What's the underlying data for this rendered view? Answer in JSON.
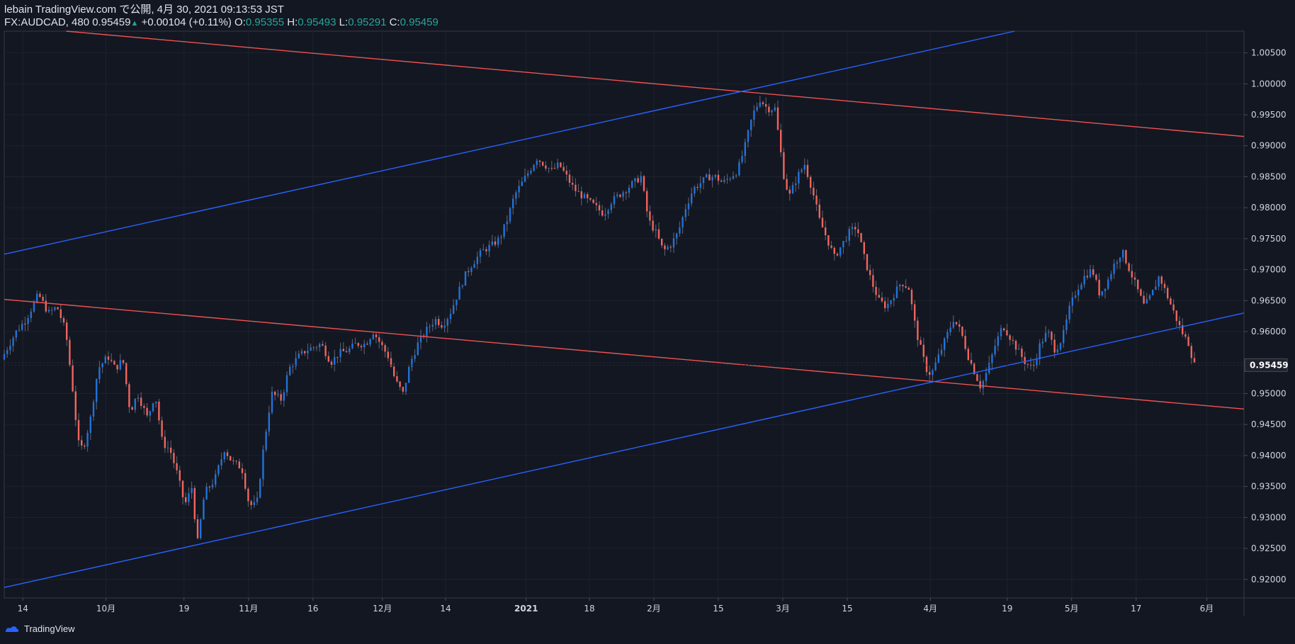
{
  "header": {
    "line1": "lebain TradingView.com で公開, 4月 30, 2021 09:13:53 JST",
    "symbol": "FX:AUDCAD, 480",
    "last": "0.95459",
    "change": "+0.00104 (+0.11%)",
    "o_label": "O:",
    "o_value": "0.95355",
    "h_label": "H:",
    "h_value": "0.95493",
    "l_label": "L:",
    "l_value": "0.95291",
    "c_label": "C:",
    "c_value": "0.95459"
  },
  "footer": {
    "brand": "TradingView"
  },
  "chart_data": {
    "type": "candlestick",
    "symbol": "FX:AUDCAD",
    "interval": "480",
    "colors": {
      "up": "#2962ff",
      "down": "#ef5350",
      "background": "#131722",
      "grid": "#1e222d",
      "up_line": "#2272d9",
      "down_line": "#f0655c"
    },
    "y_range": [
      0.917,
      1.0085
    ],
    "y_ticks": [
      "1.00500",
      "1.00000",
      "0.99500",
      "0.99000",
      "0.98500",
      "0.98000",
      "0.97500",
      "0.97000",
      "0.96500",
      "0.96000",
      "0.95500",
      "0.95000",
      "0.94500",
      "0.94000",
      "0.93500",
      "0.93000",
      "0.92500",
      "0.92000"
    ],
    "y_tick_values": [
      1.005,
      1.0,
      0.995,
      0.99,
      0.985,
      0.98,
      0.975,
      0.97,
      0.965,
      0.96,
      0.955,
      0.95,
      0.945,
      0.94,
      0.935,
      0.93,
      0.925,
      0.92
    ],
    "current_price_label": "0.95459",
    "current_price": 0.95459,
    "x_range": [
      0,
      1000
    ],
    "x_ticks": [
      {
        "label": "14",
        "x": 15
      },
      {
        "label": "10月",
        "x": 82
      },
      {
        "label": "19",
        "x": 145
      },
      {
        "label": "11月",
        "x": 197
      },
      {
        "label": "16",
        "x": 249
      },
      {
        "label": "12月",
        "x": 305
      },
      {
        "label": "14",
        "x": 356
      },
      {
        "label": "2021",
        "x": 421
      },
      {
        "label": "18",
        "x": 472
      },
      {
        "label": "2月",
        "x": 524
      },
      {
        "label": "15",
        "x": 576
      },
      {
        "label": "3月",
        "x": 628
      },
      {
        "label": "15",
        "x": 680
      },
      {
        "label": "4月",
        "x": 747
      },
      {
        "label": "19",
        "x": 809
      },
      {
        "label": "5月",
        "x": 861
      },
      {
        "label": "17",
        "x": 913
      },
      {
        "label": "6月",
        "x": 970
      }
    ],
    "price_path": [
      [
        0,
        0.9555
      ],
      [
        12,
        0.96
      ],
      [
        20,
        0.962
      ],
      [
        30,
        0.966
      ],
      [
        38,
        0.963
      ],
      [
        45,
        0.964
      ],
      [
        52,
        0.96
      ],
      [
        58,
        0.95
      ],
      [
        62,
        0.942
      ],
      [
        66,
        0.941
      ],
      [
        72,
        0.946
      ],
      [
        78,
        0.954
      ],
      [
        86,
        0.956
      ],
      [
        92,
        0.954
      ],
      [
        98,
        0.9555
      ],
      [
        104,
        0.947
      ],
      [
        110,
        0.95
      ],
      [
        118,
        0.946
      ],
      [
        124,
        0.95
      ],
      [
        130,
        0.942
      ],
      [
        136,
        0.941
      ],
      [
        142,
        0.937
      ],
      [
        148,
        0.932
      ],
      [
        154,
        0.935
      ],
      [
        158,
        0.9255
      ],
      [
        164,
        0.934
      ],
      [
        172,
        0.936
      ],
      [
        180,
        0.941
      ],
      [
        186,
        0.939
      ],
      [
        194,
        0.938
      ],
      [
        200,
        0.932
      ],
      [
        206,
        0.932
      ],
      [
        212,
        0.942
      ],
      [
        218,
        0.95
      ],
      [
        226,
        0.949
      ],
      [
        232,
        0.954
      ],
      [
        240,
        0.956
      ],
      [
        246,
        0.957
      ],
      [
        252,
        0.9575
      ],
      [
        258,
        0.958
      ],
      [
        266,
        0.955
      ],
      [
        272,
        0.9565
      ],
      [
        280,
        0.957
      ],
      [
        286,
        0.958
      ],
      [
        294,
        0.958
      ],
      [
        300,
        0.96
      ],
      [
        306,
        0.958
      ],
      [
        312,
        0.956
      ],
      [
        318,
        0.952
      ],
      [
        324,
        0.95
      ],
      [
        330,
        0.955
      ],
      [
        336,
        0.958
      ],
      [
        342,
        0.96
      ],
      [
        350,
        0.962
      ],
      [
        356,
        0.961
      ],
      [
        362,
        0.963
      ],
      [
        368,
        0.966
      ],
      [
        374,
        0.969
      ],
      [
        380,
        0.971
      ],
      [
        388,
        0.973
      ],
      [
        396,
        0.974
      ],
      [
        402,
        0.975
      ],
      [
        408,
        0.978
      ],
      [
        414,
        0.982
      ],
      [
        420,
        0.984
      ],
      [
        426,
        0.986
      ],
      [
        432,
        0.988
      ],
      [
        438,
        0.987
      ],
      [
        444,
        0.986
      ],
      [
        450,
        0.987
      ],
      [
        456,
        0.985
      ],
      [
        462,
        0.983
      ],
      [
        468,
        0.982
      ],
      [
        474,
        0.981
      ],
      [
        480,
        0.98
      ],
      [
        486,
        0.979
      ],
      [
        492,
        0.981
      ],
      [
        498,
        0.982
      ],
      [
        504,
        0.983
      ],
      [
        510,
        0.984
      ],
      [
        516,
        0.985
      ],
      [
        522,
        0.978
      ],
      [
        528,
        0.976
      ],
      [
        534,
        0.973
      ],
      [
        540,
        0.974
      ],
      [
        546,
        0.976
      ],
      [
        552,
        0.98
      ],
      [
        558,
        0.983
      ],
      [
        564,
        0.984
      ],
      [
        570,
        0.985
      ],
      [
        576,
        0.985
      ],
      [
        582,
        0.984
      ],
      [
        588,
        0.985
      ],
      [
        594,
        0.986
      ],
      [
        600,
        0.99
      ],
      [
        606,
        0.995
      ],
      [
        612,
        0.9975
      ],
      [
        618,
        0.996
      ],
      [
        624,
        0.996
      ],
      [
        628,
        0.99
      ],
      [
        632,
        0.984
      ],
      [
        636,
        0.982
      ],
      [
        642,
        0.985
      ],
      [
        648,
        0.987
      ],
      [
        654,
        0.983
      ],
      [
        660,
        0.978
      ],
      [
        666,
        0.975
      ],
      [
        672,
        0.972
      ],
      [
        678,
        0.974
      ],
      [
        684,
        0.976
      ],
      [
        690,
        0.977
      ],
      [
        696,
        0.972
      ],
      [
        702,
        0.968
      ],
      [
        708,
        0.965
      ],
      [
        714,
        0.964
      ],
      [
        720,
        0.966
      ],
      [
        726,
        0.968
      ],
      [
        732,
        0.967
      ],
      [
        738,
        0.96
      ],
      [
        742,
        0.957
      ],
      [
        746,
        0.954
      ],
      [
        750,
        0.953
      ],
      [
        756,
        0.956
      ],
      [
        762,
        0.959
      ],
      [
        768,
        0.962
      ],
      [
        774,
        0.96
      ],
      [
        780,
        0.956
      ],
      [
        786,
        0.953
      ],
      [
        790,
        0.951
      ],
      [
        796,
        0.954
      ],
      [
        802,
        0.958
      ],
      [
        808,
        0.961
      ],
      [
        814,
        0.959
      ],
      [
        820,
        0.957
      ],
      [
        826,
        0.955
      ],
      [
        832,
        0.954
      ],
      [
        838,
        0.958
      ],
      [
        844,
        0.96
      ],
      [
        850,
        0.957
      ],
      [
        856,
        0.959
      ],
      [
        862,
        0.964
      ],
      [
        868,
        0.967
      ],
      [
        874,
        0.969
      ],
      [
        880,
        0.97
      ],
      [
        886,
        0.966
      ],
      [
        892,
        0.968
      ],
      [
        898,
        0.971
      ],
      [
        904,
        0.973
      ],
      [
        910,
        0.97
      ],
      [
        916,
        0.967
      ],
      [
        922,
        0.964
      ],
      [
        928,
        0.966
      ],
      [
        934,
        0.969
      ],
      [
        940,
        0.966
      ],
      [
        946,
        0.963
      ],
      [
        952,
        0.96
      ],
      [
        958,
        0.958
      ],
      [
        962,
        0.9546
      ]
    ],
    "trendlines": [
      {
        "color": "#ef5350",
        "from": [
          50,
          1.0085
        ],
        "to": [
          1000,
          0.9915
        ]
      },
      {
        "color": "#ef5350",
        "from": [
          0,
          0.9652
        ],
        "to": [
          1000,
          0.9475
        ]
      },
      {
        "color": "#2962ff",
        "from": [
          0,
          0.9725
        ],
        "to": [
          815,
          1.0085
        ]
      },
      {
        "color": "#2962ff",
        "from": [
          0,
          0.9187
        ],
        "to": [
          1000,
          0.963
        ]
      }
    ]
  }
}
